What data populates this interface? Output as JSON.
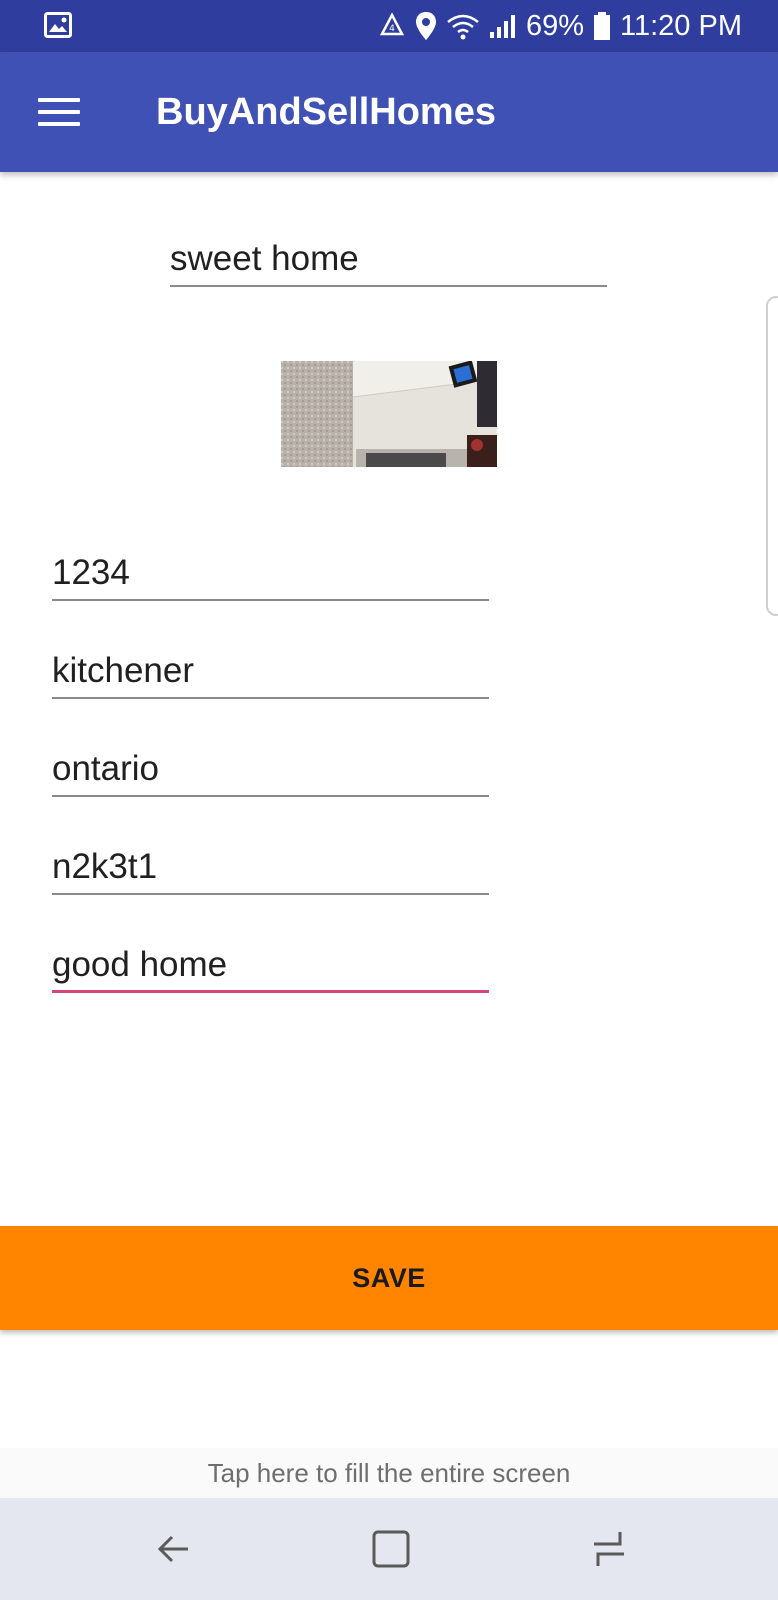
{
  "status_bar": {
    "battery": "69%",
    "time": "11:20 PM",
    "icons": [
      "gallery-icon",
      "recycle-icon",
      "location-icon",
      "wifi-icon",
      "signal-icon",
      "battery-icon"
    ]
  },
  "app_bar": {
    "title": "BuyAndSellHomes",
    "menu_icon": "hamburger-menu-icon",
    "color": "#3f51b5"
  },
  "form": {
    "title_value": "sweet home",
    "image": "room-photo",
    "fields": [
      {
        "value": "1234"
      },
      {
        "value": "kitchener"
      },
      {
        "value": "ontario"
      },
      {
        "value": "n2k3t1"
      },
      {
        "value": "good home",
        "focused": true
      }
    ],
    "focus_color": "#d6457a"
  },
  "save_button": {
    "label": "SAVE",
    "color": "#ff8500"
  },
  "fill_hint": "Tap here to fill the entire screen",
  "nav_bar": {
    "icons": [
      "back-icon",
      "home-icon",
      "recent-apps-icon"
    ]
  }
}
